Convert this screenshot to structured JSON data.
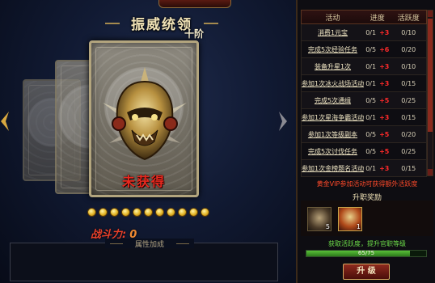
{
  "title": "振威统领",
  "rank": "十阶",
  "card_status": "未获得",
  "stars_count": 11,
  "combat_power": {
    "label": "战斗力:",
    "value": "0"
  },
  "attributes_header": "属性加成",
  "activity_table": {
    "headers": [
      "活动",
      "进度",
      "活跃度"
    ],
    "rows": [
      {
        "name": "消费1元宝",
        "progress": "0/1",
        "bonus": "+3",
        "activity": "0/10"
      },
      {
        "name": "完成5次经验任务",
        "progress": "0/5",
        "bonus": "+6",
        "activity": "0/20"
      },
      {
        "name": "装备升星1次",
        "progress": "0/1",
        "bonus": "+3",
        "activity": "0/10"
      },
      {
        "name": "参加1次冰火战场活动",
        "progress": "0/1",
        "bonus": "+3",
        "activity": "0/15"
      },
      {
        "name": "完成5次通缉",
        "progress": "0/5",
        "bonus": "+5",
        "activity": "0/25"
      },
      {
        "name": "参加1次星海争霸活动",
        "progress": "0/1",
        "bonus": "+3",
        "activity": "0/15"
      },
      {
        "name": "参加1次等级副本",
        "progress": "0/5",
        "bonus": "+5",
        "activity": "0/20"
      },
      {
        "name": "完成5次讨伐任务",
        "progress": "0/5",
        "bonus": "+5",
        "activity": "0/25"
      },
      {
        "name": "参加1次金榜题名活动",
        "progress": "0/1",
        "bonus": "+3",
        "activity": "0/15"
      }
    ]
  },
  "vip_note": "黄金VIP参加活动可获得额外活跃度",
  "reward_title": "升职奖励",
  "reward_items": [
    {
      "icon": "bust-icon",
      "count": "5"
    },
    {
      "icon": "helmet-icon",
      "count": "1"
    }
  ],
  "gain_note": "获取活跃度，提升官职等级",
  "progress_bar": {
    "text": "65/75",
    "fraction": 0.8667
  },
  "upgrade_label": "升  级"
}
